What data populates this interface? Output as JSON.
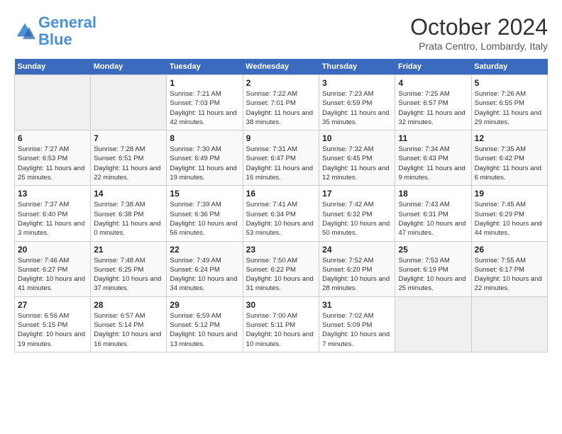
{
  "header": {
    "logo_line1": "General",
    "logo_line2": "Blue",
    "month": "October 2024",
    "location": "Prata Centro, Lombardy, Italy"
  },
  "days_of_week": [
    "Sunday",
    "Monday",
    "Tuesday",
    "Wednesday",
    "Thursday",
    "Friday",
    "Saturday"
  ],
  "weeks": [
    [
      {
        "day": "",
        "info": ""
      },
      {
        "day": "",
        "info": ""
      },
      {
        "day": "1",
        "info": "Sunrise: 7:21 AM\nSunset: 7:03 PM\nDaylight: 11 hours and 42 minutes."
      },
      {
        "day": "2",
        "info": "Sunrise: 7:22 AM\nSunset: 7:01 PM\nDaylight: 11 hours and 38 minutes."
      },
      {
        "day": "3",
        "info": "Sunrise: 7:23 AM\nSunset: 6:59 PM\nDaylight: 11 hours and 35 minutes."
      },
      {
        "day": "4",
        "info": "Sunrise: 7:25 AM\nSunset: 6:57 PM\nDaylight: 11 hours and 32 minutes."
      },
      {
        "day": "5",
        "info": "Sunrise: 7:26 AM\nSunset: 6:55 PM\nDaylight: 11 hours and 29 minutes."
      }
    ],
    [
      {
        "day": "6",
        "info": "Sunrise: 7:27 AM\nSunset: 6:53 PM\nDaylight: 11 hours and 25 minutes."
      },
      {
        "day": "7",
        "info": "Sunrise: 7:28 AM\nSunset: 6:51 PM\nDaylight: 11 hours and 22 minutes."
      },
      {
        "day": "8",
        "info": "Sunrise: 7:30 AM\nSunset: 6:49 PM\nDaylight: 11 hours and 19 minutes."
      },
      {
        "day": "9",
        "info": "Sunrise: 7:31 AM\nSunset: 6:47 PM\nDaylight: 11 hours and 16 minutes."
      },
      {
        "day": "10",
        "info": "Sunrise: 7:32 AM\nSunset: 6:45 PM\nDaylight: 11 hours and 12 minutes."
      },
      {
        "day": "11",
        "info": "Sunrise: 7:34 AM\nSunset: 6:43 PM\nDaylight: 11 hours and 9 minutes."
      },
      {
        "day": "12",
        "info": "Sunrise: 7:35 AM\nSunset: 6:42 PM\nDaylight: 11 hours and 6 minutes."
      }
    ],
    [
      {
        "day": "13",
        "info": "Sunrise: 7:37 AM\nSunset: 6:40 PM\nDaylight: 11 hours and 3 minutes."
      },
      {
        "day": "14",
        "info": "Sunrise: 7:38 AM\nSunset: 6:38 PM\nDaylight: 11 hours and 0 minutes."
      },
      {
        "day": "15",
        "info": "Sunrise: 7:39 AM\nSunset: 6:36 PM\nDaylight: 10 hours and 56 minutes."
      },
      {
        "day": "16",
        "info": "Sunrise: 7:41 AM\nSunset: 6:34 PM\nDaylight: 10 hours and 53 minutes."
      },
      {
        "day": "17",
        "info": "Sunrise: 7:42 AM\nSunset: 6:32 PM\nDaylight: 10 hours and 50 minutes."
      },
      {
        "day": "18",
        "info": "Sunrise: 7:43 AM\nSunset: 6:31 PM\nDaylight: 10 hours and 47 minutes."
      },
      {
        "day": "19",
        "info": "Sunrise: 7:45 AM\nSunset: 6:29 PM\nDaylight: 10 hours and 44 minutes."
      }
    ],
    [
      {
        "day": "20",
        "info": "Sunrise: 7:46 AM\nSunset: 6:27 PM\nDaylight: 10 hours and 41 minutes."
      },
      {
        "day": "21",
        "info": "Sunrise: 7:48 AM\nSunset: 6:25 PM\nDaylight: 10 hours and 37 minutes."
      },
      {
        "day": "22",
        "info": "Sunrise: 7:49 AM\nSunset: 6:24 PM\nDaylight: 10 hours and 34 minutes."
      },
      {
        "day": "23",
        "info": "Sunrise: 7:50 AM\nSunset: 6:22 PM\nDaylight: 10 hours and 31 minutes."
      },
      {
        "day": "24",
        "info": "Sunrise: 7:52 AM\nSunset: 6:20 PM\nDaylight: 10 hours and 28 minutes."
      },
      {
        "day": "25",
        "info": "Sunrise: 7:53 AM\nSunset: 6:19 PM\nDaylight: 10 hours and 25 minutes."
      },
      {
        "day": "26",
        "info": "Sunrise: 7:55 AM\nSunset: 6:17 PM\nDaylight: 10 hours and 22 minutes."
      }
    ],
    [
      {
        "day": "27",
        "info": "Sunrise: 6:56 AM\nSunset: 5:15 PM\nDaylight: 10 hours and 19 minutes."
      },
      {
        "day": "28",
        "info": "Sunrise: 6:57 AM\nSunset: 5:14 PM\nDaylight: 10 hours and 16 minutes."
      },
      {
        "day": "29",
        "info": "Sunrise: 6:59 AM\nSunset: 5:12 PM\nDaylight: 10 hours and 13 minutes."
      },
      {
        "day": "30",
        "info": "Sunrise: 7:00 AM\nSunset: 5:11 PM\nDaylight: 10 hours and 10 minutes."
      },
      {
        "day": "31",
        "info": "Sunrise: 7:02 AM\nSunset: 5:09 PM\nDaylight: 10 hours and 7 minutes."
      },
      {
        "day": "",
        "info": ""
      },
      {
        "day": "",
        "info": ""
      }
    ]
  ]
}
